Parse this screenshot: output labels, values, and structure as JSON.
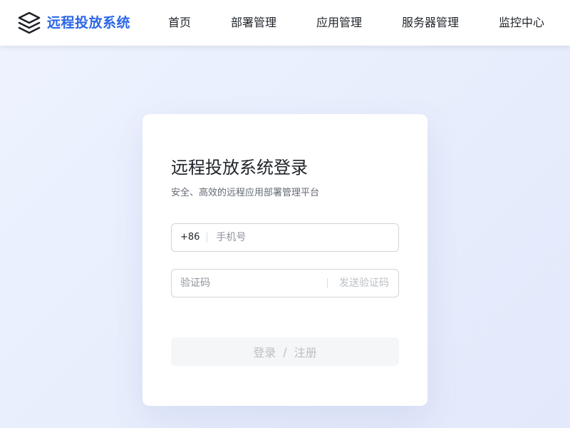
{
  "header": {
    "brand_title": "远程投放系统",
    "brand_icon": "layers-icon",
    "nav": [
      {
        "label": "首页"
      },
      {
        "label": "部署管理"
      },
      {
        "label": "应用管理"
      },
      {
        "label": "服务器管理"
      },
      {
        "label": "监控中心"
      }
    ]
  },
  "login": {
    "title": "远程投放系统登录",
    "subtitle": "安全、高效的远程应用部署管理平台",
    "phone": {
      "prefix": "+86",
      "placeholder": "手机号",
      "value": ""
    },
    "code": {
      "placeholder": "验证码",
      "value": "",
      "send_label": "发送验证码"
    },
    "submit": {
      "login_label": "登录",
      "separator": "/",
      "register_label": "注册",
      "disabled": true
    }
  },
  "colors": {
    "brand": "#2a66e8",
    "text_primary": "#1f2329",
    "text_secondary": "#646a73",
    "placeholder": "#8f959e",
    "disabled_text": "#bbbfc4",
    "disabled_bg": "#f5f6f7",
    "page_bg": "#eaf0fd"
  }
}
